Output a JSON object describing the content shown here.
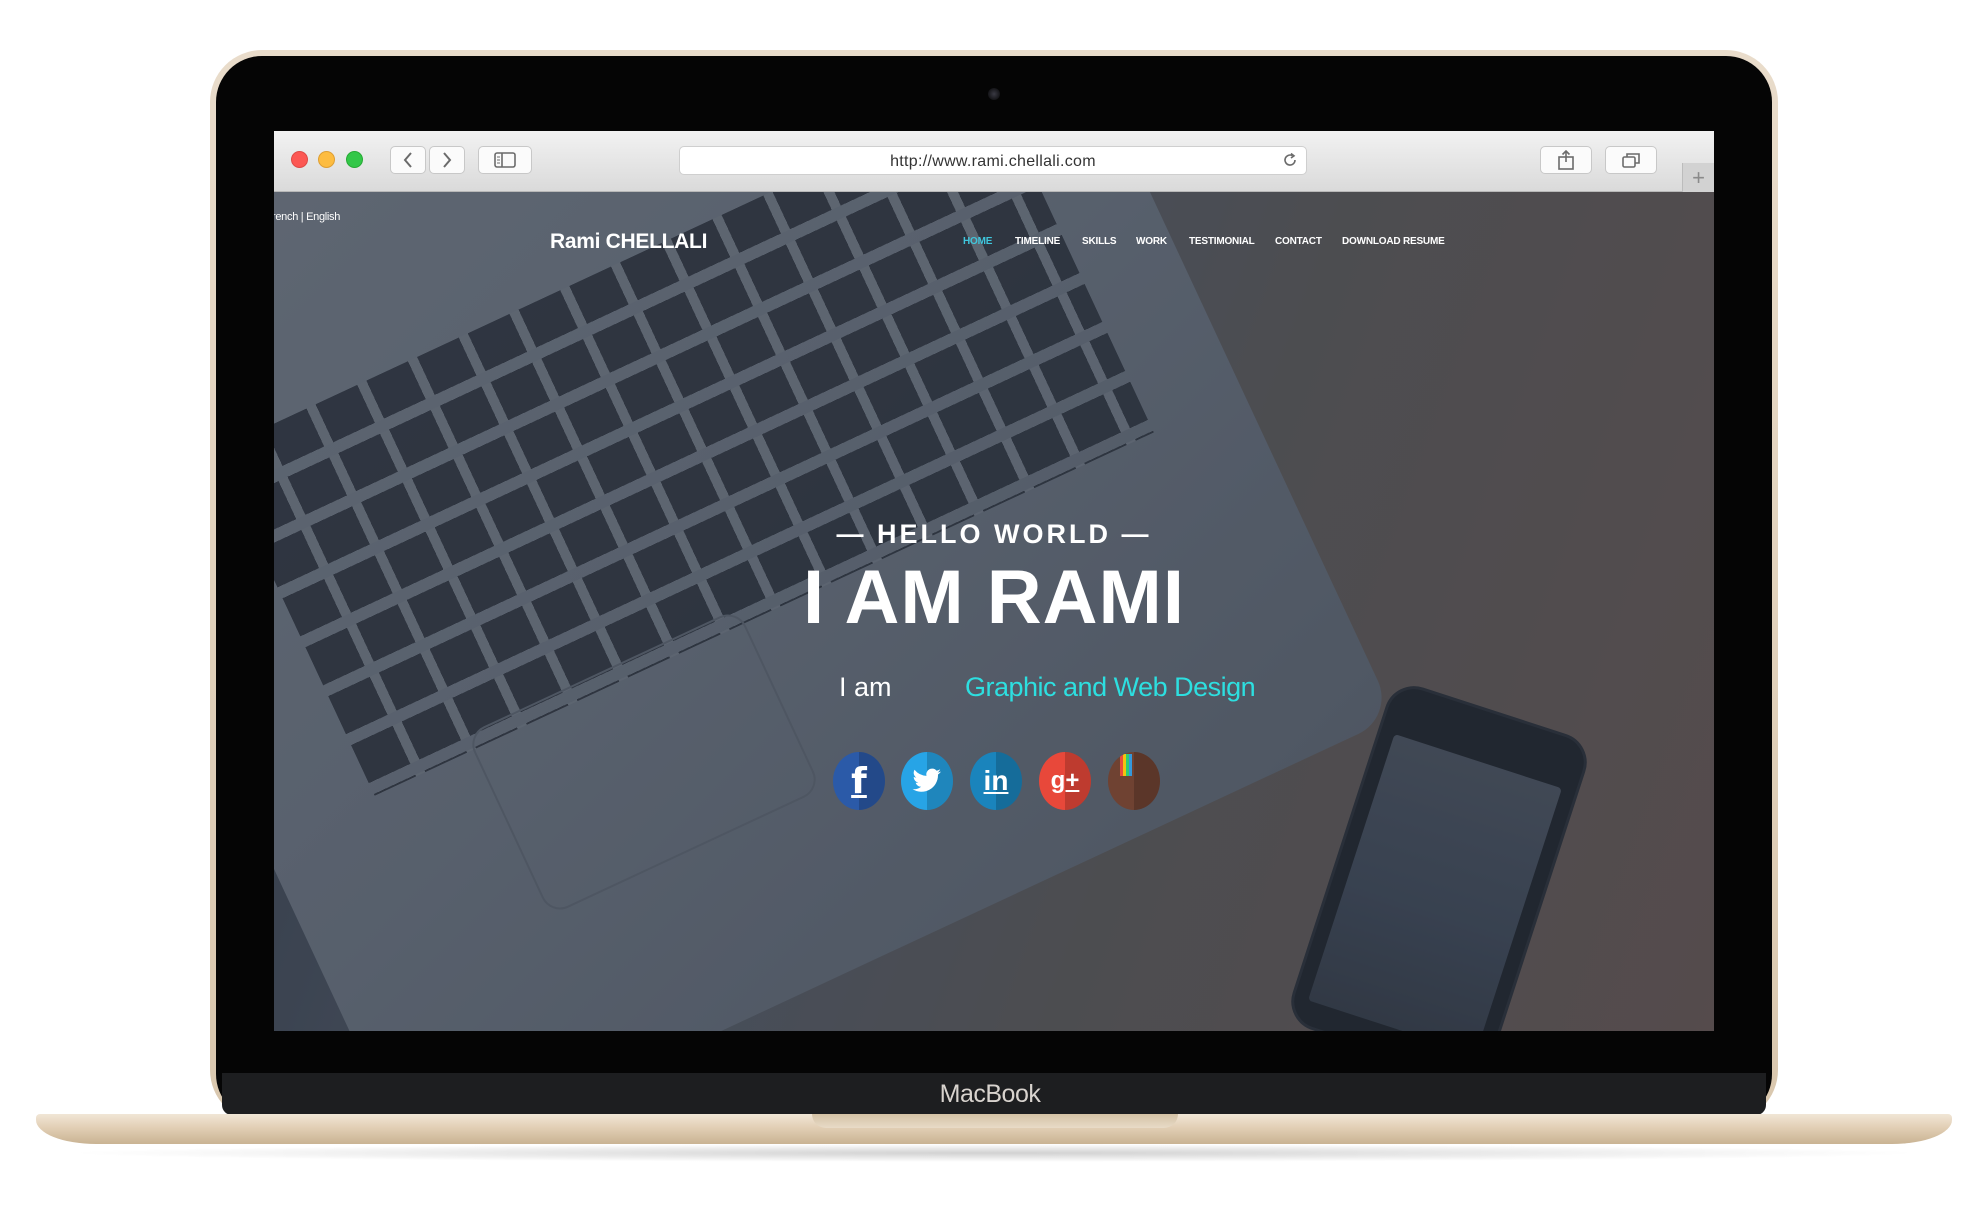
{
  "device": {
    "label": "MacBook"
  },
  "browser": {
    "url": "http://www.rami.chellali.com",
    "controls": {
      "close": "close",
      "minimize": "minimize",
      "zoom": "zoom",
      "back_icon": "chevron-left-icon",
      "forward_icon": "chevron-right-icon",
      "sidebar_icon": "sidebar-icon",
      "reload_icon": "reload-icon",
      "share_icon": "share-icon",
      "tabs_icon": "tabs-overview-icon",
      "new_tab_glyph": "+"
    }
  },
  "site": {
    "language_switch": "rench | English",
    "brand": "Rami CHELLALI",
    "nav": [
      {
        "label": "HOME",
        "active": true
      },
      {
        "label": "TIMELINE",
        "active": false
      },
      {
        "label": "SKILLS",
        "active": false
      },
      {
        "label": "WORK",
        "active": false
      },
      {
        "label": "TESTIMONIAL",
        "active": false
      },
      {
        "label": "CONTACT",
        "active": false
      },
      {
        "label": "DOWNLOAD RESUME",
        "active": false
      }
    ],
    "hero": {
      "kicker": "— HELLO WORLD —",
      "headline": "I AM RAMI",
      "intro": "I am",
      "role": "Graphic and Web Design"
    },
    "social": [
      {
        "network": "facebook",
        "glyph": "f",
        "color": "#2b5aa8"
      },
      {
        "network": "twitter",
        "glyph": "",
        "color": "#27a4e6"
      },
      {
        "network": "linkedin",
        "glyph": "in",
        "color": "#1a84bc"
      },
      {
        "network": "google-plus",
        "glyph": "g+",
        "color": "#e8483a"
      },
      {
        "network": "instagram",
        "glyph": "",
        "color": "#6f4232"
      }
    ],
    "colors": {
      "accent": "#2ddfe0",
      "nav_active": "#3fc6dc"
    }
  }
}
